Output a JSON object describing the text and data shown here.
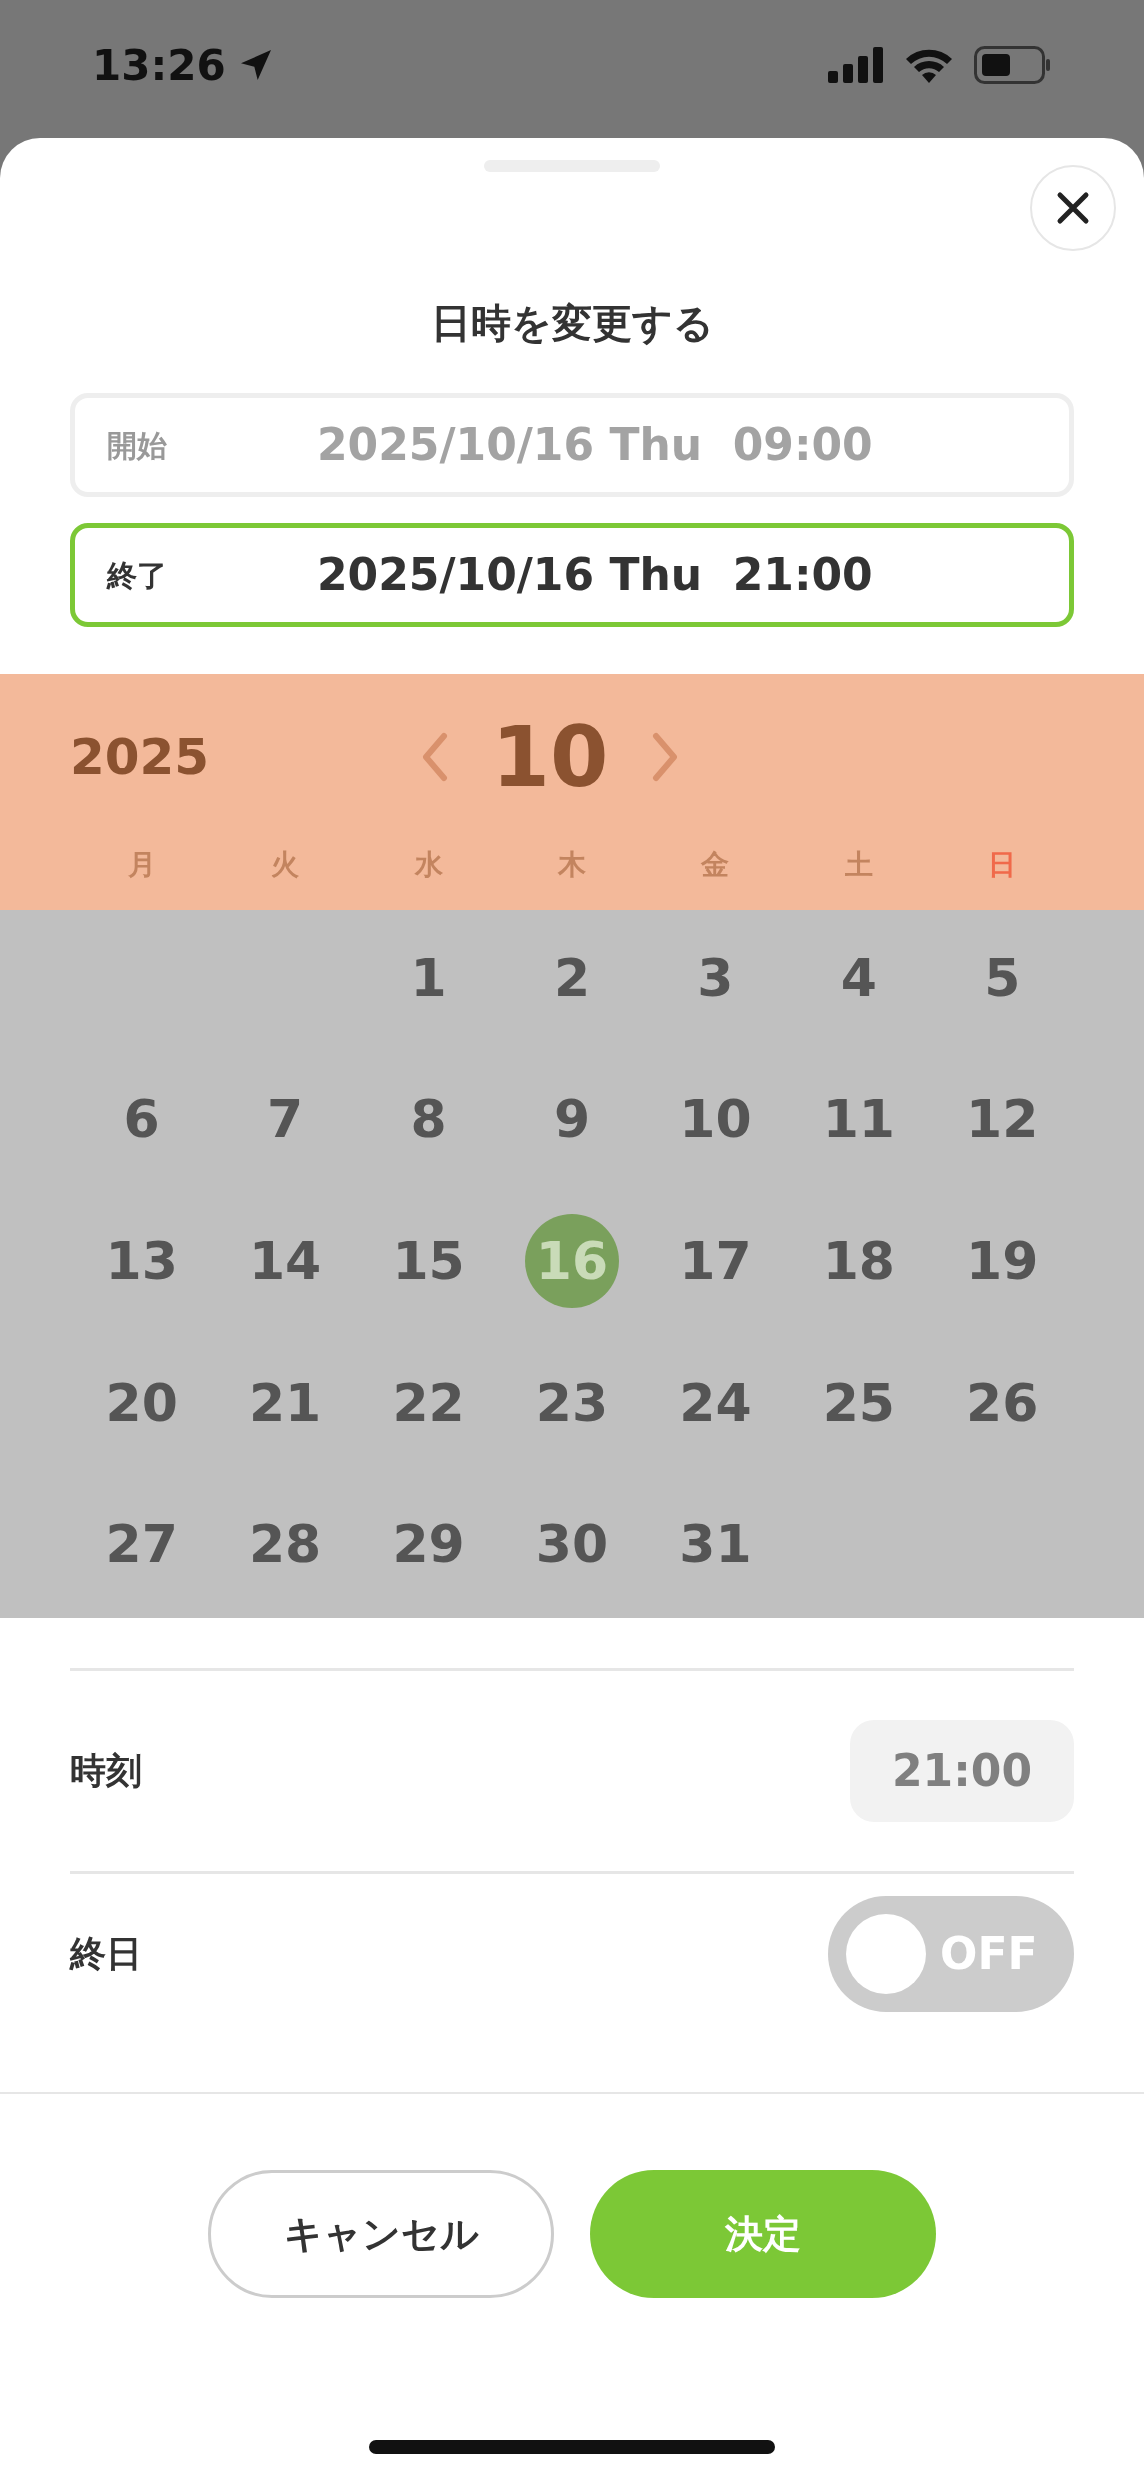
{
  "status_bar": {
    "time": "13:26"
  },
  "sheet": {
    "title": "日時を変更する"
  },
  "range_fields": [
    {
      "label": "開始",
      "value": "2025/10/16 Thu  09:00",
      "selected": false
    },
    {
      "label": "終了",
      "value": "2025/10/16 Thu  21:00",
      "selected": true
    }
  ],
  "calendar": {
    "year": "2025",
    "month": "10",
    "weekdays": [
      {
        "label": "月",
        "kind": "weekday"
      },
      {
        "label": "火",
        "kind": "weekday"
      },
      {
        "label": "水",
        "kind": "weekday"
      },
      {
        "label": "木",
        "kind": "weekday"
      },
      {
        "label": "金",
        "kind": "weekday"
      },
      {
        "label": "土",
        "kind": "weekday"
      },
      {
        "label": "日",
        "kind": "sunday"
      }
    ],
    "weeks": [
      [
        {
          "label": "1",
          "selected": false
        },
        {
          "label": "2",
          "selected": false
        },
        {
          "label": "3",
          "selected": false
        },
        {
          "label": "4",
          "selected": false
        },
        {
          "label": "5",
          "selected": false
        }
      ],
      [
        {
          "label": "6",
          "selected": false
        },
        {
          "label": "7",
          "selected": false
        },
        {
          "label": "8",
          "selected": false
        },
        {
          "label": "9",
          "selected": false
        },
        {
          "label": "10",
          "selected": false
        },
        {
          "label": "11",
          "selected": false
        },
        {
          "label": "12",
          "selected": false
        }
      ],
      [
        {
          "label": "13",
          "selected": false
        },
        {
          "label": "14",
          "selected": false
        },
        {
          "label": "15",
          "selected": false
        },
        {
          "label": "16",
          "selected": true
        },
        {
          "label": "17",
          "selected": false
        },
        {
          "label": "18",
          "selected": false
        },
        {
          "label": "19",
          "selected": false
        }
      ],
      [
        {
          "label": "20",
          "selected": false
        },
        {
          "label": "21",
          "selected": false
        },
        {
          "label": "22",
          "selected": false
        },
        {
          "label": "23",
          "selected": false
        },
        {
          "label": "24",
          "selected": false
        },
        {
          "label": "25",
          "selected": false
        },
        {
          "label": "26",
          "selected": false
        }
      ],
      [
        {
          "label": "27",
          "selected": false
        },
        {
          "label": "28",
          "selected": false
        },
        {
          "label": "29",
          "selected": false
        },
        {
          "label": "30",
          "selected": false
        },
        {
          "label": "31",
          "selected": false
        }
      ]
    ]
  },
  "settings": [
    {
      "kind": "time",
      "label": "時刻",
      "value": "21:00"
    },
    {
      "kind": "toggle",
      "label": "終日",
      "on": false,
      "state_text": "OFF"
    }
  ],
  "buttons": [
    {
      "label": "キャンセル",
      "kind": "secondary"
    },
    {
      "label": "決定",
      "kind": "primary"
    }
  ]
}
